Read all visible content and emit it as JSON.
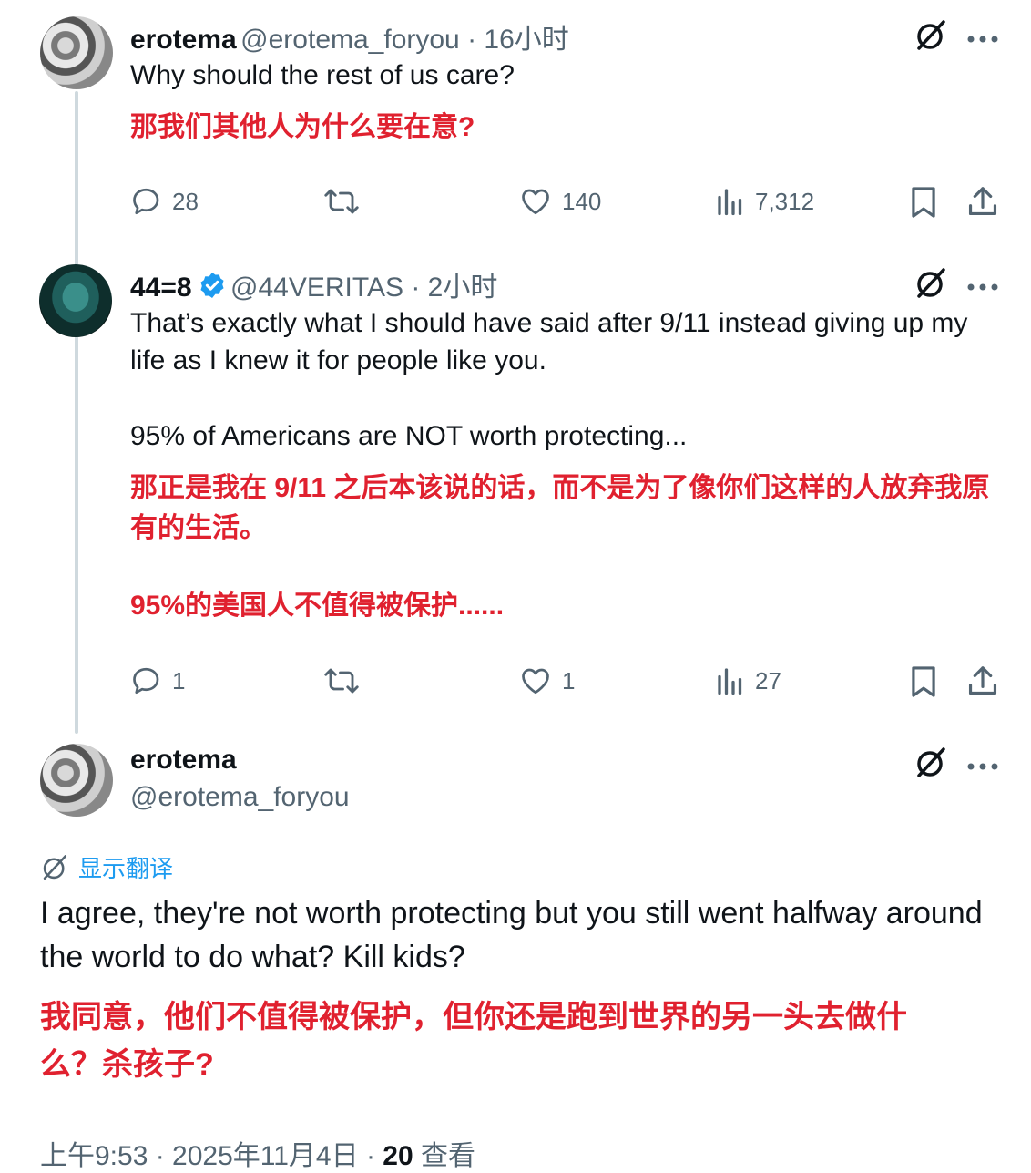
{
  "tweets": [
    {
      "name": "erotema",
      "handle_time": "@erotema_foryou · 16小时",
      "text_en": "Why should the rest of us care?",
      "text_zh": "那我们其他人为什么要在意?",
      "replies": "28",
      "likes": "140",
      "views": "7,312"
    },
    {
      "name": "44=8",
      "handle_time": "@44VERITAS · 2小时",
      "text_en_1": "That’s exactly what I should have said after 9/11 instead giving up my life as I knew it for people like you.",
      "text_en_2": "95% of Americans are NOT worth protecting...",
      "text_zh_1": "那正是我在 9/11 之后本该说的话，而不是为了像你们这样的人放弃我原有的生活。",
      "text_zh_2": "95%的美国人不值得被保护......",
      "replies": "1",
      "likes": "1",
      "views": "27"
    }
  ],
  "main_tweet": {
    "name": "erotema",
    "handle": "@erotema_foryou",
    "translate_label": "显示翻译",
    "text_en": "I agree, they're not worth protecting but you still went halfway around the world to do what? Kill kids?",
    "text_zh": "我同意，他们不值得被保护，但你还是跑到世界的另一头去做什么？杀孩子?",
    "time": "上午9:53 · 2025年11月4日 · ",
    "views_count": "20",
    "views_label": "查看"
  },
  "colors": {
    "accent": "#1d9bf0",
    "translation_red": "#e0212f",
    "muted": "#536471"
  }
}
